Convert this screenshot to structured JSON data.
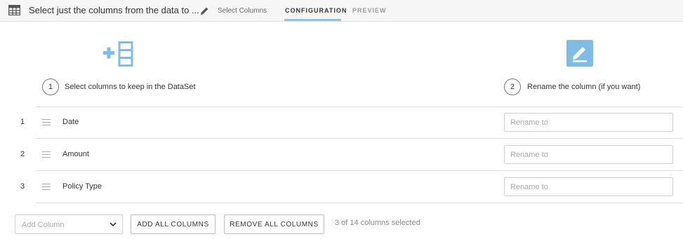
{
  "header": {
    "title": "Select just the columns from the data to ...",
    "subtitle": "Select Columns",
    "tabs": [
      {
        "label": "CONFIGURATION",
        "active": true
      },
      {
        "label": "PREVIEW",
        "active": false
      }
    ],
    "icons": {
      "recipe": "table-icon",
      "edit": "pencil-icon"
    },
    "accent_color": "#8fc3e6"
  },
  "steps": [
    {
      "number": "1",
      "label": "Select columns to keep in the DataSet",
      "icon": "add-columns-icon"
    },
    {
      "number": "2",
      "label": "Rename the column (if you want)",
      "icon": "rename-icon"
    }
  ],
  "columns": [
    {
      "index": "1",
      "name": "Date",
      "rename_placeholder": "Rename to",
      "rename_value": ""
    },
    {
      "index": "2",
      "name": "Amount",
      "rename_placeholder": "Rename to",
      "rename_value": ""
    },
    {
      "index": "3",
      "name": "Policy Type",
      "rename_placeholder": "Rename to",
      "rename_value": ""
    }
  ],
  "footer": {
    "add_column_placeholder": "Add Column",
    "add_all_label": "ADD ALL COLUMNS",
    "remove_all_label": "REMOVE ALL COLUMNS",
    "selected_count_text": "3 of 14 columns selected"
  }
}
